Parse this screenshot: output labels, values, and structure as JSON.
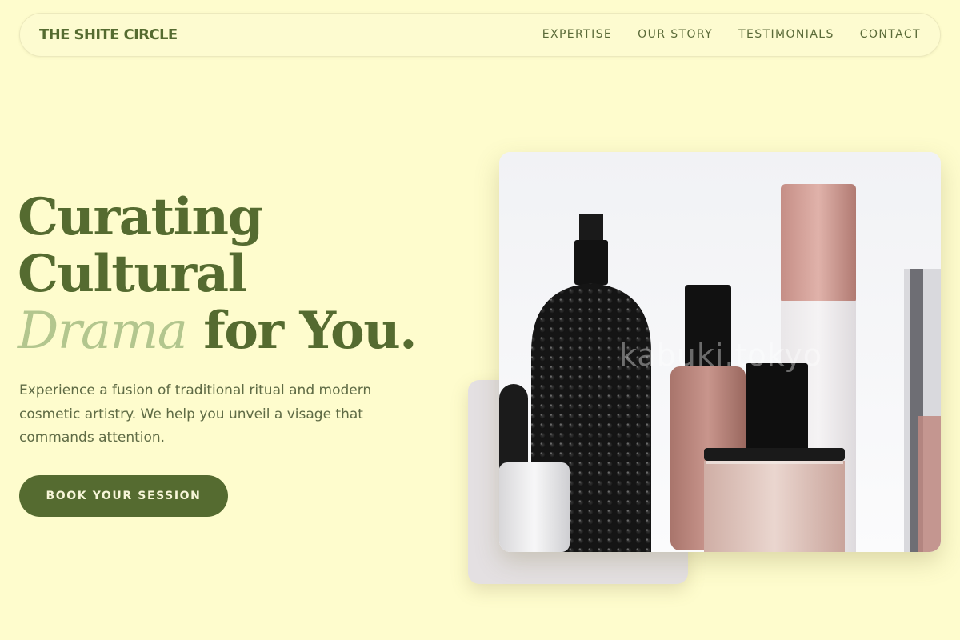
{
  "brand": "THE SHITE CIRCLE",
  "nav": {
    "links": [
      "EXPERTISE",
      "OUR STORY",
      "TESTIMONIALS",
      "CONTACT"
    ]
  },
  "hero": {
    "title_line1": "Curating",
    "title_line2": "Cultural",
    "title_accent": "Drama",
    "title_rest": " for You.",
    "description": "Experience a fusion of traditional ritual and modern cosmetic artistry. We help you unveil a visage that commands attention.",
    "cta_label": "BOOK YOUR SESSION"
  },
  "image": {
    "watermark": "kabuki.tokyo"
  },
  "colors": {
    "background": "#fefccd",
    "primary": "#556b30",
    "accent": "#b3c68e"
  }
}
